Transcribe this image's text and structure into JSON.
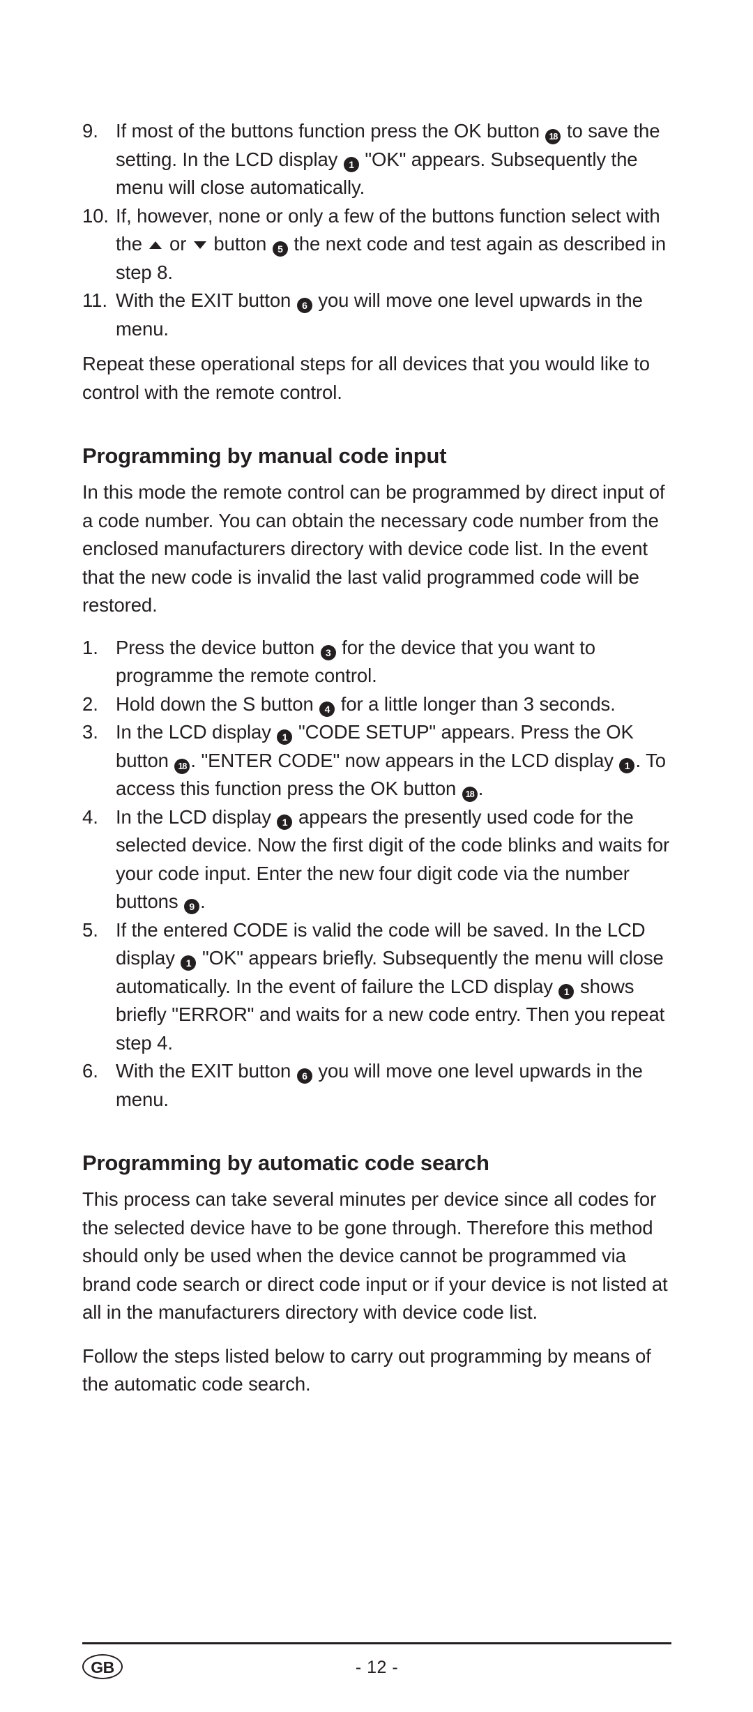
{
  "document": {
    "language_badge": "GB",
    "page_number": "- 12 -"
  },
  "top_list": {
    "items": [
      {
        "number": "9.",
        "parts": [
          {
            "t": "text",
            "v": "If most of the buttons function press the OK button "
          },
          {
            "t": "cnum",
            "v": "18"
          },
          {
            "t": "text",
            "v": " to save the setting. In the LCD display "
          },
          {
            "t": "cnum",
            "v": "1"
          },
          {
            "t": "text",
            "v": " \"OK\" appears. Subsequently the menu will close automatically."
          }
        ]
      },
      {
        "number": "10.",
        "parts": [
          {
            "t": "text",
            "v": "If, however, none or only a few of the buttons function select with the "
          },
          {
            "t": "tri-up",
            "v": "▲"
          },
          {
            "t": "text",
            "v": " or "
          },
          {
            "t": "tri-down",
            "v": "▼"
          },
          {
            "t": "text",
            "v": " button "
          },
          {
            "t": "cnum",
            "v": "5"
          },
          {
            "t": "text",
            "v": " the next code and test again as described in step 8."
          }
        ]
      },
      {
        "number": "11.",
        "parts": [
          {
            "t": "text",
            "v": "With the EXIT button "
          },
          {
            "t": "cnum",
            "v": "6"
          },
          {
            "t": "text",
            "v": " you will move one level upwards in the menu."
          }
        ]
      }
    ]
  },
  "repeat_paragraph": "Repeat these operational steps for all devices that you would like to control with the remote control.",
  "section_manual": {
    "heading": "Programming by manual code input",
    "intro": "In this mode the remote control can be programmed by direct input of a code number. You can obtain the necessary code number from the enclosed manufacturers directory with device code list. In the event that the new code is invalid the last valid programmed code will be restored.",
    "items": [
      {
        "number": "1.",
        "parts": [
          {
            "t": "text",
            "v": "Press the device button "
          },
          {
            "t": "cnum",
            "v": "3"
          },
          {
            "t": "text",
            "v": " for the device that you want to programme the remote control."
          }
        ]
      },
      {
        "number": "2.",
        "parts": [
          {
            "t": "text",
            "v": "Hold down the S button "
          },
          {
            "t": "cnum",
            "v": "4"
          },
          {
            "t": "text",
            "v": " for a little longer than 3 seconds."
          }
        ]
      },
      {
        "number": "3.",
        "parts": [
          {
            "t": "text",
            "v": "In the LCD display "
          },
          {
            "t": "cnum",
            "v": "1"
          },
          {
            "t": "text",
            "v": " \"CODE SETUP\" appears. Press the OK button "
          },
          {
            "t": "cnum",
            "v": "18"
          },
          {
            "t": "text",
            "v": ". \"ENTER CODE\" now appears in the LCD display "
          },
          {
            "t": "cnum",
            "v": "1"
          },
          {
            "t": "text",
            "v": ". To access this function press the OK button "
          },
          {
            "t": "cnum",
            "v": "18"
          },
          {
            "t": "text",
            "v": "."
          }
        ]
      },
      {
        "number": "4.",
        "parts": [
          {
            "t": "text",
            "v": "In the LCD display "
          },
          {
            "t": "cnum",
            "v": "1"
          },
          {
            "t": "text",
            "v": " appears the presently used code for the selected device. Now the first digit of the code blinks and waits for your code input. Enter the new four digit code via the number buttons "
          },
          {
            "t": "cnum",
            "v": "9"
          },
          {
            "t": "text",
            "v": "."
          }
        ]
      },
      {
        "number": "5.",
        "parts": [
          {
            "t": "text",
            "v": "If the entered CODE is valid the code will be saved. In the LCD display "
          },
          {
            "t": "cnum",
            "v": "1"
          },
          {
            "t": "text",
            "v": " \"OK\" appears briefly. Subsequently the menu will close automatically. In the event of failure the LCD display "
          },
          {
            "t": "cnum",
            "v": "1"
          },
          {
            "t": "text",
            "v": " shows briefly \"ERROR\" and waits for a new code entry. Then you repeat step 4."
          }
        ]
      },
      {
        "number": "6.",
        "parts": [
          {
            "t": "text",
            "v": "With the EXIT button "
          },
          {
            "t": "cnum",
            "v": "6"
          },
          {
            "t": "text",
            "v": " you will move one level upwards in the menu."
          }
        ]
      }
    ]
  },
  "section_automatic": {
    "heading": "Programming by automatic code search",
    "paragraph_1": "This process can take several minutes per device since all codes for the selected device have to be gone through. Therefore this method should only be used when the device cannot be programmed via brand code search or direct code input or if your device is not listed at all in the manufacturers directory with device code list.",
    "paragraph_2": "Follow the steps listed below to carry out programming by means of the automatic code search."
  }
}
